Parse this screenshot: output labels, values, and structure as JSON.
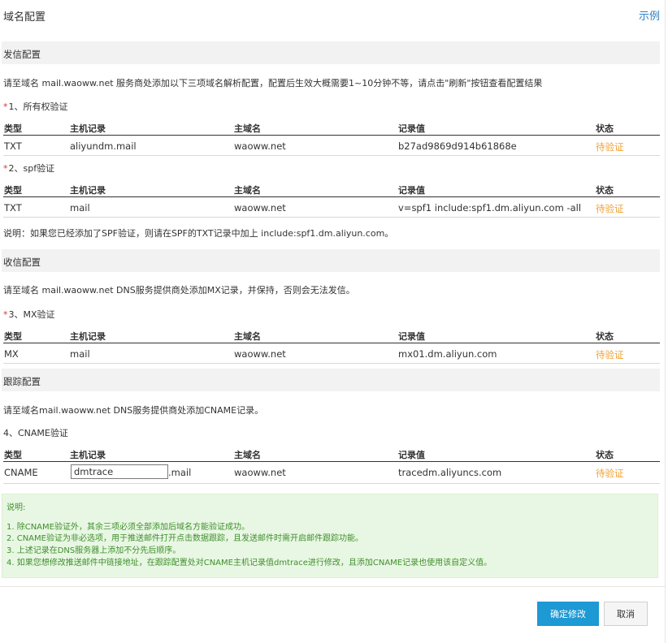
{
  "header": {
    "title": "域名配置",
    "example_link": "示例"
  },
  "columns": {
    "type": "类型",
    "host": "主机记录",
    "domain": "主域名",
    "value": "记录值",
    "status": "状态"
  },
  "send": {
    "section_title": "发信配置",
    "description": "请至域名 mail.waoww.net 服务商处添加以下三项域名解析配置，配置后生效大概需要1~10分钟不等，请点击\"刷新\"按钮查看配置结果",
    "ownership": {
      "required_mark": "*",
      "title": "1、所有权验证",
      "row": {
        "type": "TXT",
        "host": "aliyundm.mail",
        "domain": "waoww.net",
        "value": "b27ad9869d914b61868e",
        "status": "待验证"
      }
    },
    "spf": {
      "required_mark": "*",
      "title": "2、spf验证",
      "row": {
        "type": "TXT",
        "host": "mail",
        "domain": "waoww.net",
        "value": "v=spf1 include:spf1.dm.aliyun.com -all",
        "status": "待验证"
      }
    },
    "note": "说明：如果您已经添加了SPF验证，则请在SPF的TXT记录中加上 include:spf1.dm.aliyun.com。"
  },
  "receive": {
    "section_title": "收信配置",
    "description": "请至域名 mail.waoww.net DNS服务提供商处添加MX记录，并保持，否则会无法发信。",
    "mx": {
      "required_mark": "*",
      "title": "3、MX验证",
      "row": {
        "type": "MX",
        "host": "mail",
        "domain": "waoww.net",
        "value": "mx01.dm.aliyun.com",
        "status": "待验证"
      }
    }
  },
  "tracking": {
    "section_title": "跟踪配置",
    "description": "请至域名mail.waoww.net DNS服务提供商处添加CNAME记录。",
    "cname": {
      "title": "4、CNAME验证",
      "row": {
        "type": "CNAME",
        "host_value": "dmtrace",
        "host_suffix": ".mail",
        "domain": "waoww.net",
        "value": "tracedm.aliyuncs.com",
        "status": "待验证"
      }
    }
  },
  "notice": {
    "title": "说明:",
    "lines": [
      "1. 除CNAME验证外，其余三项必须全部添加后域名方能验证成功。",
      "2. CNAME验证为非必选项，用于推送邮件打开点击数据跟踪，且发送邮件时需开启邮件跟踪功能。",
      "3. 上述记录在DNS服务器上添加不分先后顺序。",
      "4. 如果您想修改推送邮件中链接地址，在跟踪配置处对CNAME主机记录值dmtrace进行修改，且添加CNAME记录也使用该自定义值。"
    ]
  },
  "footer": {
    "confirm_label": "确定修改",
    "cancel_label": "取消"
  },
  "colors": {
    "accent": "#1d99d3",
    "link": "#2b7fc3",
    "pending": "#f0a030",
    "required": "#e0322b",
    "notice_bg": "#e8f7e3",
    "notice_text": "#3f8f2c"
  }
}
